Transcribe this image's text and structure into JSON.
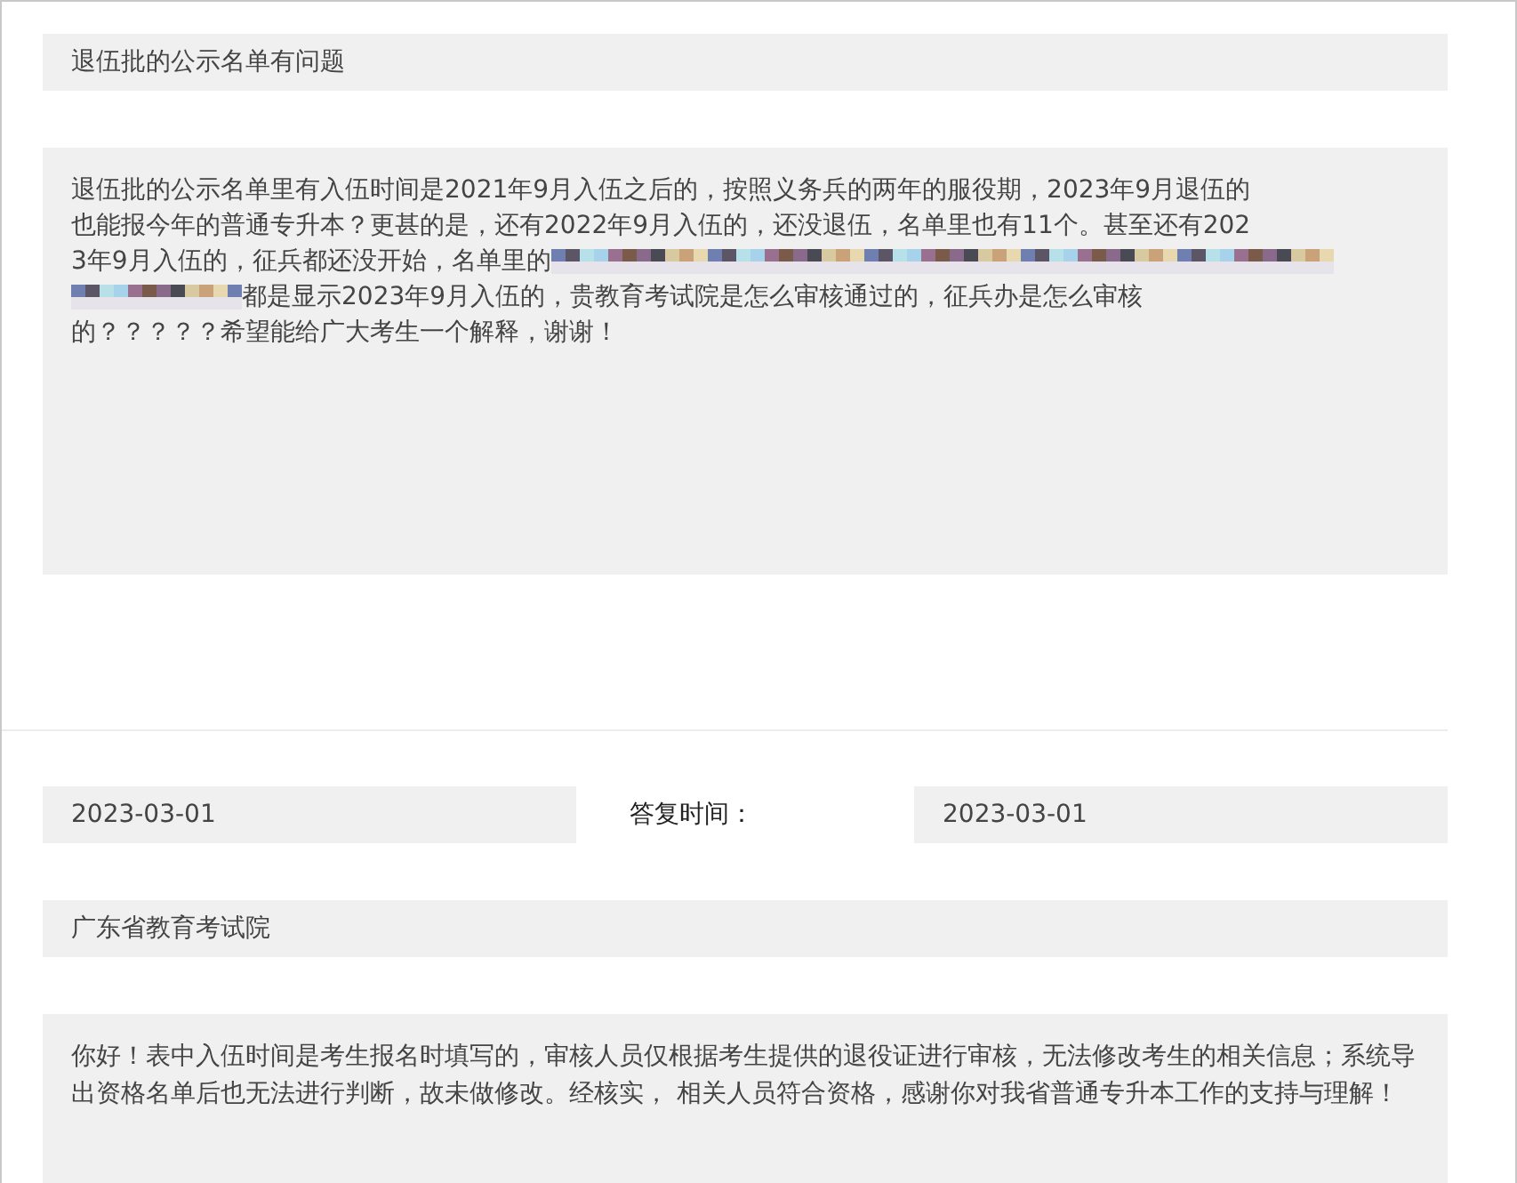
{
  "question": {
    "title": "退伍批的公示名单有问题",
    "body_lines": [
      [
        {
          "kind": "text",
          "text": "退伍批的公示名单里有入伍时间是2021年9月入伍之后的，按照义务兵的两年的服役期，2023年9月退伍的"
        }
      ],
      [
        {
          "kind": "text",
          "text": "也能报今年的普通专升本？更甚的是，还有2022年9月入伍的，还没退伍，名单里也有11个。甚至还有202"
        }
      ],
      [
        {
          "kind": "text",
          "text": "3年9月入伍的，征兵都还没开始，名单里的"
        },
        {
          "kind": "redaction"
        }
      ],
      [
        {
          "kind": "redaction"
        },
        {
          "kind": "text",
          "text": "都是显示2023年9月入伍的，贵教育考试院是怎么审核通过的，征兵办是怎么审核"
        }
      ],
      [
        {
          "kind": "text",
          "text": "的？？？？？希望能给广大考生一个解释，谢谢！"
        }
      ]
    ]
  },
  "reply": {
    "date": "2023-03-01",
    "time_label": "答复时间：",
    "reply_date": "2023-03-01",
    "responder": "广东省教育考试院",
    "answer": "你好！表中入伍时间是考生报名时填写的，审核人员仅根据考生提供的退役证进行审核，无法修改考生的相关信息；系统导出资格名单后也无法进行判断，故未做修改。经核实， 相关人员符合资格，感谢你对我省普通专升本工作的支持与理解！"
  }
}
